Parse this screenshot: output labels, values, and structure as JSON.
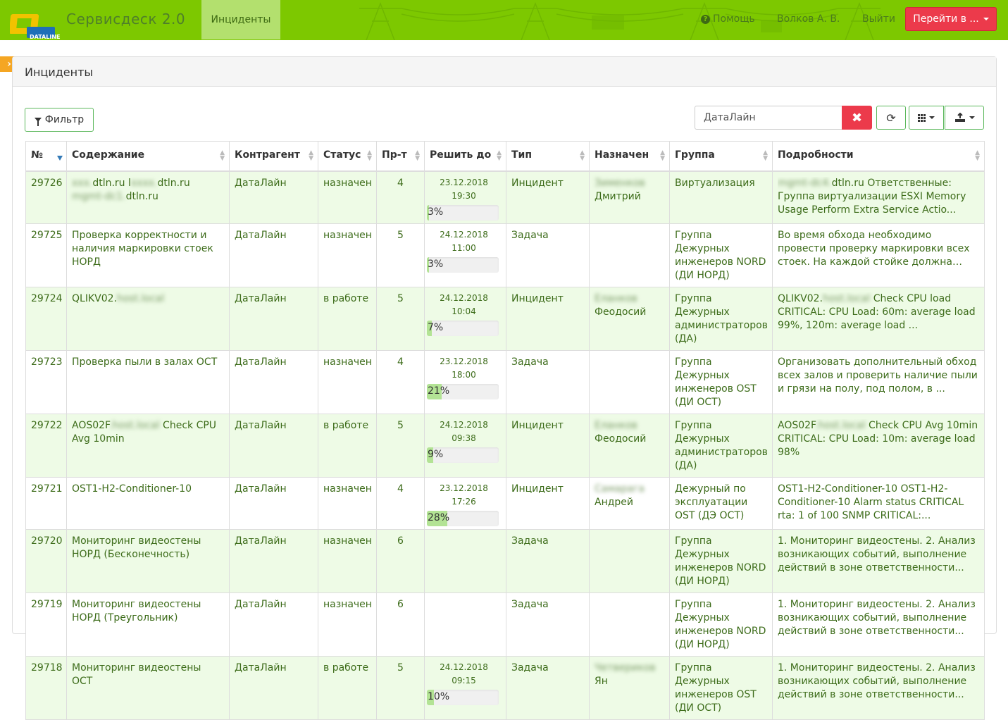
{
  "navbar": {
    "logo_text": "DATALINE",
    "brand": "Сервисдеск 2.0",
    "active_tab": "Инциденты",
    "help": "Помощь",
    "user": "Волков А. В.",
    "logout": "Выйти",
    "goto": "Перейти в ..."
  },
  "panel": {
    "title": "Инциденты",
    "filter_label": "Фильтр",
    "search_value": "ДатаЛайн"
  },
  "table": {
    "headers": {
      "num": "№",
      "content": "Содержание",
      "counterparty": "Контрагент",
      "status": "Статус",
      "priority": "Пр-т",
      "due": "Решить до",
      "type": "Тип",
      "assigned": "Назначен",
      "group": "Группа",
      "details": "Подробности"
    },
    "rows": [
      {
        "num": "29726",
        "content_blur1": "xxx.",
        "content1": "dtln.ru l",
        "content_blur2": "xxxx.",
        "content2": "dtln.ru",
        "content_blur3": "mgmt-dc1.",
        "content3": "dtln.ru",
        "counterparty": "ДатаЛайн",
        "status": "назначен",
        "priority": "4",
        "due_date": "23.12.2018",
        "due_time": "19:30",
        "progress_pct": 3,
        "progress_text": "3%",
        "type": "Инцидент",
        "assigned_blur": "Зименков",
        "assigned": "Дмитрий",
        "group": "Виртуализация",
        "details_blur": "mgmt-dc4.",
        "details": "dtln.ru Ответственные: Группа виртуализации ESXI Memory Usage Perform Extra Service Actio..."
      },
      {
        "num": "29725",
        "content": "Проверка корректности и наличия маркировки стоек НОРД",
        "counterparty": "ДатаЛайн",
        "status": "назначен",
        "priority": "5",
        "due_date": "24.12.2018",
        "due_time": "11:00",
        "progress_pct": 3,
        "progress_text": "3%",
        "type": "Задача",
        "assigned": "",
        "group": "Группа Дежурных инженеров NORD (ДИ НОРД)",
        "details": "Во время обхода необходимо провести проверку маркировки всех стоек. На каждой стойке должна быть ма..."
      },
      {
        "num": "29724",
        "content": "QLIKV02.",
        "content_blur": "host.local",
        "counterparty": "ДатаЛайн",
        "status": "в работе",
        "priority": "5",
        "due_date": "24.12.2018",
        "due_time": "10:04",
        "progress_pct": 7,
        "progress_text": "7%",
        "type": "Инцидент",
        "assigned_blur": "Еланков",
        "assigned": "Феодосий",
        "group": "Группа Дежурных администраторов (ДА)",
        "details_pre": "QLIKV02.",
        "details_blur": "host.local",
        "details": " Check CPU load CRITICAL: CPU Load: 60m: average load 99%, 120m: average load ..."
      },
      {
        "num": "29723",
        "content": "Проверка пыли в залах ОСТ",
        "counterparty": "ДатаЛайн",
        "status": "назначен",
        "priority": "4",
        "due_date": "23.12.2018",
        "due_time": "18:00",
        "progress_pct": 21,
        "progress_text": "21%",
        "type": "Задача",
        "assigned": "",
        "group": "Группа Дежурных инженеров OST (ДИ ОСТ)",
        "details": "Организовать дополнительный обход всех залов и проверить наличие пыли и грязи на полу, под полом, в ..."
      },
      {
        "num": "29722",
        "content": "AOS02F",
        "content_blur": ".host.local",
        "content_post": " Check CPU Avg 10min",
        "counterparty": "ДатаЛайн",
        "status": "в работе",
        "priority": "5",
        "due_date": "24.12.2018",
        "due_time": "09:38",
        "progress_pct": 9,
        "progress_text": "9%",
        "type": "Инцидент",
        "assigned_blur": "Еланков",
        "assigned": "Феодосий",
        "group": "Группа Дежурных администраторов (ДА)",
        "details_pre": "AOS02F",
        "details_blur": ".host.local",
        "details": " Check CPU Avg 10min CRITICAL: CPU Load: 10m: average load 98%"
      },
      {
        "num": "29721",
        "content": "OST1-H2-Conditioner-10",
        "counterparty": "ДатаЛайн",
        "status": "назначен",
        "priority": "4",
        "due_date": "23.12.2018",
        "due_time": "17:26",
        "progress_pct": 28,
        "progress_text": "28%",
        "type": "Инцидент",
        "assigned_blur": "Самарага",
        "assigned": "Андрей",
        "group": "Дежурный по эксплуатации OST (ДЭ ОСТ)",
        "details": "OST1-H2-Conditioner-10 OST1-H2-Conditioner-10 Alarm status CRITICAL rta: 1 of 100 SNMP CRITICAL:..."
      },
      {
        "num": "29720",
        "content": "Мониторинг видеостены НОРД (Бесконечность)",
        "counterparty": "ДатаЛайн",
        "status": "назначен",
        "priority": "6",
        "type": "Задача",
        "assigned": "",
        "group": "Группа Дежурных инженеров NORD (ДИ НОРД)",
        "details": "1. Мониторинг видеостены. 2. Анализ возникающих событий, выполнение действий в зоне ответственности..."
      },
      {
        "num": "29719",
        "content": "Мониторинг видеостены НОРД (Треугольник)",
        "counterparty": "ДатаЛайн",
        "status": "назначен",
        "priority": "6",
        "type": "Задача",
        "assigned": "",
        "group": "Группа Дежурных инженеров NORD (ДИ НОРД)",
        "details": "1. Мониторинг видеостены. 2. Анализ возникающих событий, выполнение действий в зоне ответственности..."
      },
      {
        "num": "29718",
        "content": "Мониторинг видеостены ОСТ",
        "counterparty": "ДатаЛайн",
        "status": "в работе",
        "priority": "5",
        "due_date": "24.12.2018",
        "due_time": "09:15",
        "progress_pct": 10,
        "progress_text": "10%",
        "type": "Задача",
        "assigned_blur": "Четвериков",
        "assigned": "Ян",
        "group": "Группа Дежурных инженеров OST (ДИ ОСТ)",
        "details": "1. Мониторинг видеостены. 2. Анализ возникающих событий, выполнение действий в зоне ответственности..."
      }
    ]
  },
  "colors": {
    "navbar_bg": "#7dc800",
    "danger": "#ec3a4b",
    "row_odd": "#eefbe6",
    "progress_fill": "#b3e395",
    "sidebar_toggle": "#f5a623"
  },
  "icons": [
    "dataline-logo",
    "help-icon",
    "caret-down-icon",
    "chevron-right-icon",
    "filter-icon",
    "close-icon",
    "refresh-icon",
    "columns-icon",
    "export-icon",
    "sort-icon"
  ]
}
